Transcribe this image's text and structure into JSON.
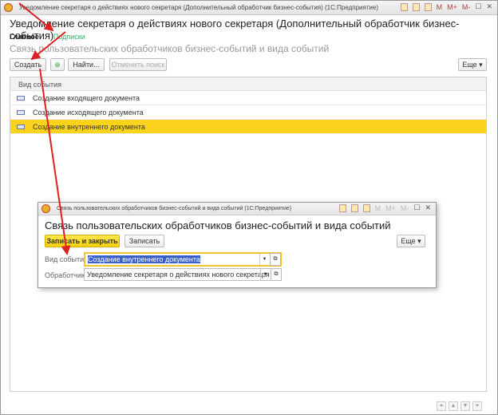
{
  "window": {
    "title": "Уведомление секретаря о действиях нового секретаря (Дополнительный обработчик бизнес-события)  (1С:Предприятие)",
    "heading": "Уведомление секретаря о действиях нового секретаря (Дополнительный обработчик бизнес-события)",
    "titlebar_buttons": [
      "M",
      "M+",
      "M-"
    ]
  },
  "tabs": [
    {
      "label": "Главное",
      "active": true
    },
    {
      "label": "Подписки",
      "active": false
    }
  ],
  "subtitle": "Связь пользовательских обработчиков бизнес-событий и вида событий",
  "toolbar": {
    "create": "Создать",
    "find": "Найти...",
    "cancel_search": "Отменить поиск",
    "more": "Еще ▾"
  },
  "table": {
    "header": "Вид события",
    "rows": [
      "Создание входящего документа",
      "Создание исходящего документа",
      "Создание внутреннего документа"
    ],
    "selected_index": 2
  },
  "dialog": {
    "title": "Связь пользовательских обработчиков бизнес-событий и вида событий  (1С:Предприятие)",
    "heading": "Связь пользовательских обработчиков бизнес-событий и вида событий",
    "save_close": "Записать и закрыть",
    "save": "Записать",
    "more": "Еще ▾",
    "event_label": "Вид события:",
    "event_value": "Создание внутреннего документа",
    "handler_label": "Обработчик:",
    "handler_value": "Уведомление секретаря о действиях нового секретаря"
  },
  "colors": {
    "accent": "#fcd31c",
    "arrow": "#e02020",
    "tab_link": "#3aa866"
  }
}
